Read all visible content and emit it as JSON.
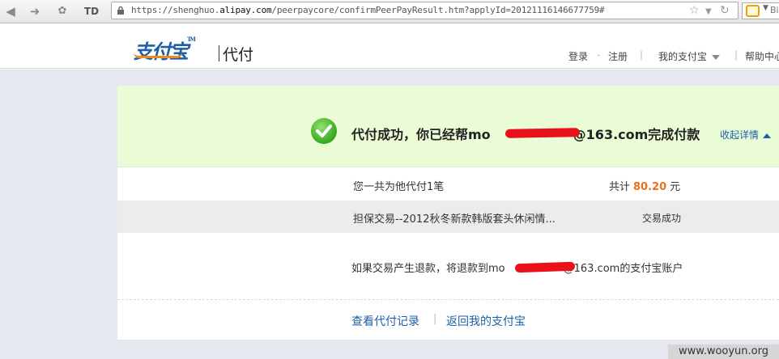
{
  "browser": {
    "back_icon": "arrow-left-icon",
    "forward_icon": "arrow-right-icon",
    "url_prefix": "https://shenghuo.",
    "url_host": "alipay.com",
    "url_path": "/peerpaycore/confirmPeerPayResult.htm?applyId=20121116146677759#",
    "search_text": "Bi"
  },
  "header": {
    "logo_text": "支付宝",
    "logo_tm": "TM",
    "product_name": "代付",
    "login": "登录",
    "dash": "-",
    "register": "注册",
    "sep": "|",
    "my_alipay": "我的支付宝",
    "help": "帮助中心"
  },
  "result": {
    "message_prefix": "代付成功，你已经帮mo",
    "message_suffix": "@163.com完成付款",
    "collapse": "收起详情",
    "summary_text": "您一共为他代付1笔",
    "total_label": "共计",
    "total_amount": "80.20",
    "currency": "元",
    "item_name": "担保交易--2012秋冬新款韩版套头休闲情...",
    "item_status": "交易成功",
    "refund_prefix": "如果交易产生退款，将退款到mo",
    "refund_suffix": "@163.com的支付宝账户",
    "view_records": "查看代付记录",
    "link_sep": "|",
    "back_to_alipay": "返回我的支付宝"
  },
  "watermark": "www.wooyun.org"
}
